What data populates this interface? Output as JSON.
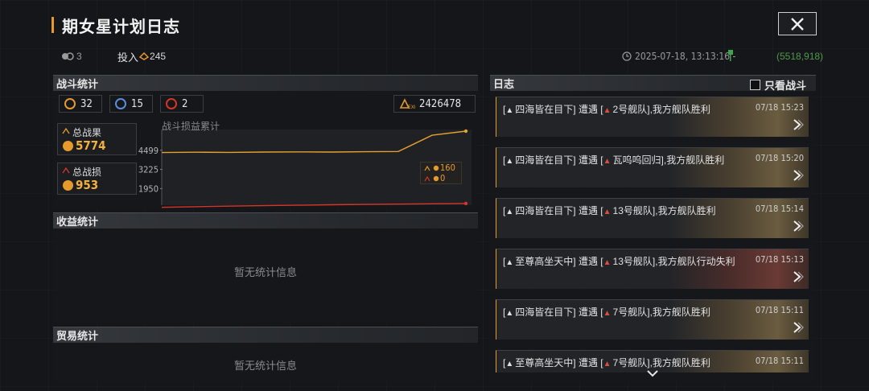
{
  "header": {
    "title": "期女星计划日志",
    "ships_count": "3",
    "invest_label": "投入",
    "invest_amount": "245",
    "timestamp": "2025-07-18, 13:13:16 -",
    "coords": "(5518,918)"
  },
  "battle": {
    "title": "战斗统计",
    "stat1": "32",
    "stat2": "15",
    "stat3": "2",
    "exp": "2426478",
    "total_result_label": "总战果",
    "total_result_value": "5774",
    "total_loss_label": "总战损",
    "total_loss_value": "953",
    "legend_gain": "160",
    "legend_loss": "0"
  },
  "chart_data": {
    "type": "line",
    "title": "战斗损益累计",
    "y_ticks": [
      "4499",
      "3225",
      "1950"
    ],
    "ylim": [
      950,
      5774
    ],
    "series": [
      {
        "values": [
          4350,
          4370,
          4360,
          4380,
          4390,
          4380,
          4400,
          4420,
          5500,
          5774
        ],
        "color": "#e8a030"
      },
      {
        "values": [
          700,
          740,
          780,
          810,
          840,
          870,
          890,
          910,
          935,
          953
        ],
        "color": "#d8352a"
      }
    ]
  },
  "income": {
    "title": "收益统计",
    "empty": "暂无统计信息"
  },
  "trade": {
    "title": "贸易统计",
    "empty": "暂无统计信息"
  },
  "log": {
    "title": "日志",
    "filter_label": "只看战斗",
    "entries": [
      {
        "actor": "四海皆在目下",
        "verb": "遭遇",
        "enemy": "2号舰队",
        "result": ",我方舰队胜利",
        "time": "07/18 15:23"
      },
      {
        "actor": "四海皆在目下",
        "verb": "遭遇",
        "enemy": "瓦呜呜回归",
        "result": ",我方舰队胜利",
        "time": "07/18 15:20"
      },
      {
        "actor": "四海皆在目下",
        "verb": "遭遇",
        "enemy": "13号舰队",
        "result": ",我方舰队胜利",
        "time": "07/18 15:14"
      },
      {
        "actor": "至尊高坐天中",
        "verb": "遭遇",
        "enemy": "13号舰队",
        "result": ",我方舰队行动失利",
        "time": "07/18 15:13"
      },
      {
        "actor": "四海皆在目下",
        "verb": "遭遇",
        "enemy": "7号舰队",
        "result": ",我方舰队胜利",
        "time": "07/18 15:11"
      },
      {
        "actor": "至尊高坐天中",
        "verb": "遭遇",
        "enemy": "7号舰队",
        "result": ",我方舰队胜利",
        "time": "07/18 15:11"
      }
    ]
  }
}
